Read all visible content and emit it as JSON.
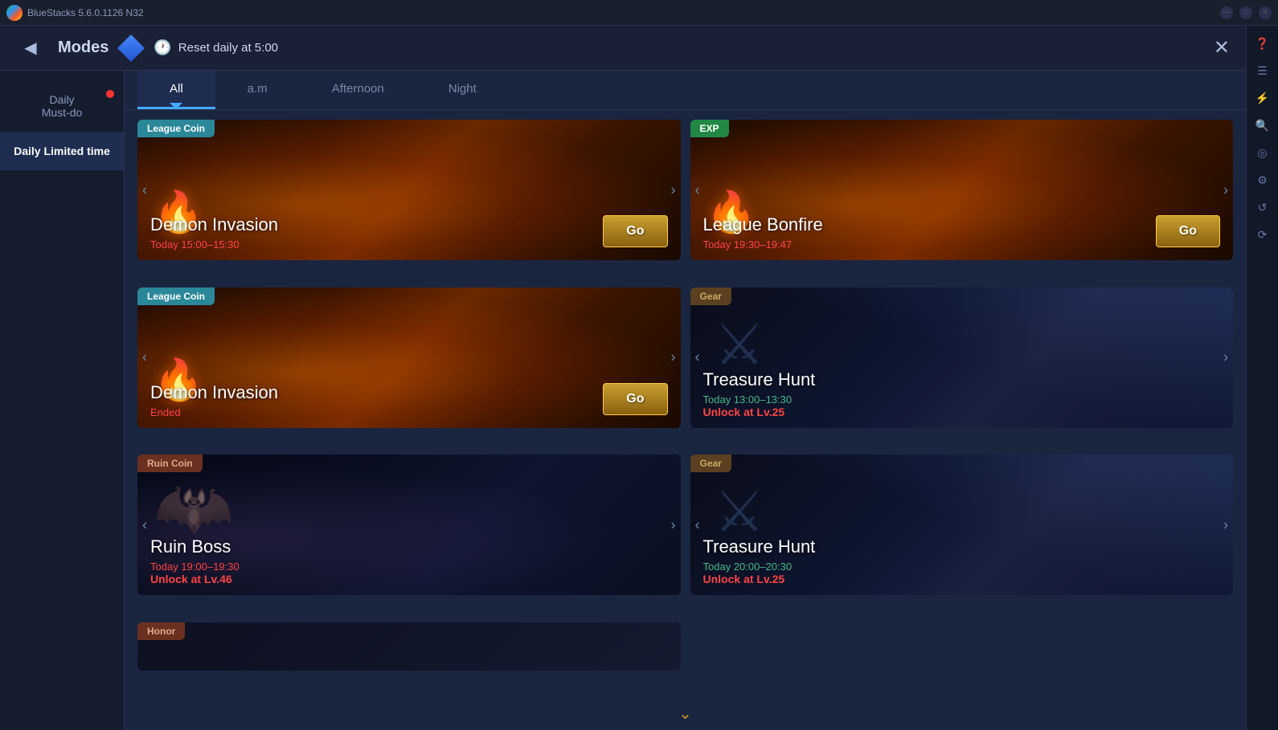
{
  "titlebar": {
    "app_name": "BlueStacks 5.6.0.1126 N32",
    "logo_alt": "BlueStacks logo"
  },
  "header": {
    "back_label": "◀",
    "title": "Modes",
    "reset_label": "Reset daily at 5:00",
    "close_label": "✕"
  },
  "sidebar": {
    "items": [
      {
        "id": "daily-must-do",
        "label": "Daily\nMust-do",
        "active": false,
        "has_dot": true
      },
      {
        "id": "daily-limited-time",
        "label": "Daily Limited time",
        "active": true,
        "has_dot": false
      }
    ]
  },
  "tabs": {
    "items": [
      {
        "id": "all",
        "label": "All",
        "active": true
      },
      {
        "id": "am",
        "label": "a.m",
        "active": false
      },
      {
        "id": "afternoon",
        "label": "Afternoon",
        "active": false
      },
      {
        "id": "night",
        "label": "Night",
        "active": false
      }
    ]
  },
  "cards": [
    {
      "id": "demon-invasion-1",
      "tag": "League Coin",
      "tag_class": "tag-league",
      "bg_class": "card-bg-fire",
      "title": "Demon Invasion",
      "time": "Today 15:00–15:30",
      "time_class": "card-time",
      "has_go": true,
      "go_label": "Go",
      "unlock": "",
      "visual": "flame"
    },
    {
      "id": "league-bonfire",
      "tag": "EXP",
      "tag_class": "tag-exp",
      "bg_class": "card-bg-fire",
      "title": "League Bonfire",
      "time": "Today 19:30–19:47",
      "time_class": "card-time",
      "has_go": true,
      "go_label": "Go",
      "unlock": "",
      "visual": "flame"
    },
    {
      "id": "demon-invasion-2",
      "tag": "League Coin",
      "tag_class": "tag-league",
      "bg_class": "card-bg-fire",
      "title": "Demon Invasion",
      "time": "Ended",
      "time_class": "card-status-ended",
      "has_go": true,
      "go_label": "Go",
      "unlock": "",
      "visual": "flame"
    },
    {
      "id": "treasure-hunt-1",
      "tag": "Gear",
      "tag_class": "tag-gear",
      "bg_class": "card-bg-gear",
      "title": "Treasure Hunt",
      "time": "Today 13:00–13:30",
      "time_class": "card-time green",
      "has_go": false,
      "go_label": "",
      "unlock": "Unlock at Lv.25",
      "visual": "gear"
    },
    {
      "id": "ruin-boss",
      "tag": "Ruin Coin",
      "tag_class": "tag-ruin",
      "bg_class": "card-bg-ruin",
      "title": "Ruin Boss",
      "time": "Today 19:00–19:30",
      "time_class": "card-time",
      "has_go": false,
      "go_label": "",
      "unlock": "Unlock at Lv.46",
      "visual": "ruin"
    },
    {
      "id": "treasure-hunt-2",
      "tag": "Gear",
      "tag_class": "tag-gear",
      "bg_class": "card-bg-gear",
      "title": "Treasure Hunt",
      "time": "Today 20:00–20:30",
      "time_class": "card-time green",
      "has_go": false,
      "go_label": "",
      "unlock": "Unlock at Lv.25",
      "visual": "gear"
    },
    {
      "id": "honor",
      "tag": "Honor",
      "tag_class": "tag-ruin",
      "bg_class": "card-bg-honor",
      "title": "",
      "time": "",
      "time_class": "",
      "has_go": false,
      "go_label": "",
      "unlock": "",
      "visual": "none",
      "partial": true
    }
  ],
  "toolbar_icons": [
    "❓",
    "☰",
    "⚡",
    "⟳",
    "◎",
    "⚙",
    "↺"
  ],
  "scroll_indicator": "⌄",
  "colors": {
    "accent": "#4af",
    "bg_dark": "#1a2035",
    "sidebar_active": "#1e2d50"
  }
}
